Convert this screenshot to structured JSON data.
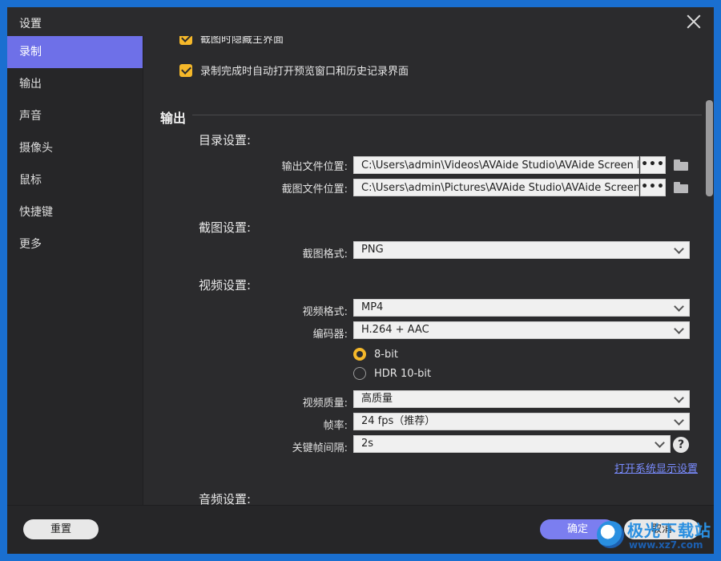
{
  "window": {
    "title": "设置"
  },
  "sidebar": {
    "items": [
      {
        "label": "录制"
      },
      {
        "label": "输出"
      },
      {
        "label": "声音"
      },
      {
        "label": "摄像头"
      },
      {
        "label": "鼠标"
      },
      {
        "label": "快捷键"
      },
      {
        "label": "更多"
      }
    ],
    "active": "录制"
  },
  "recording_options": {
    "hide_on_screenshot": "截图时隐藏主界面",
    "auto_open_preview": "录制完成时自动打开预览窗口和历史记录界面"
  },
  "output": {
    "section_title": "输出",
    "directory": {
      "title": "目录设置:",
      "output_label": "输出文件位置:",
      "output_path": "C:\\Users\\admin\\Videos\\AVAide Studio\\AVAide Screen R",
      "screenshot_label": "截图文件位置:",
      "screenshot_path": "C:\\Users\\admin\\Pictures\\AVAide Studio\\AVAide Screen",
      "browse_label": "•••"
    },
    "screenshot": {
      "title": "截图设置:",
      "format_label": "截图格式:",
      "format_value": "PNG"
    },
    "video": {
      "title": "视频设置:",
      "format_label": "视频格式:",
      "format_value": "MP4",
      "encoder_label": "编码器:",
      "encoder_value": "H.264 + AAC",
      "bit_depth_options": [
        "8-bit",
        "HDR 10-bit"
      ],
      "bit_depth_selected": "8-bit",
      "quality_label": "视频质量:",
      "quality_value": "高质量",
      "fps_label": "帧率:",
      "fps_value": "24 fps（推荐）",
      "keyframe_label": "关键帧间隔:",
      "keyframe_value": "2s",
      "help_label": "?",
      "display_settings_link": "打开系统显示设置"
    },
    "audio": {
      "title": "音频设置:"
    }
  },
  "footer": {
    "reset_label": "重置",
    "ok_label": "确定",
    "cancel_label": "取消"
  },
  "watermark": {
    "text": "极光下载站",
    "url": "www.xz7.com"
  },
  "colors": {
    "accent": "#6e70e8",
    "checkbox": "#f5b82a",
    "link": "#7a8cff",
    "background": "#2b2b2d",
    "desktop": "#1a6fd0"
  }
}
